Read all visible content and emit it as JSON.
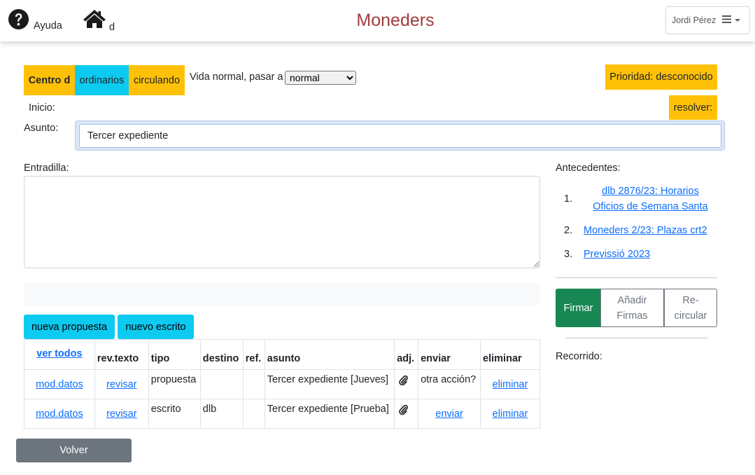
{
  "navbar": {
    "help_label": "Ayuda",
    "home_label": "d",
    "title": "Moneders",
    "user_name": "Jordi Pérez"
  },
  "status": {
    "centro": "Centro d",
    "ordinarios": "ordinarios",
    "circulando": "circulando",
    "vida_label": "Vida normal, pasar a",
    "vida_selected": "normal",
    "prioridad": "Prioridad: desconocido",
    "resolver": "resolver:"
  },
  "form": {
    "inicio_label": "Inicio:",
    "asunto_label": "Asunto:",
    "asunto_value": "Tercer expediente",
    "entradilla_label": "Entradilla:",
    "entradilla_value": ""
  },
  "actions": {
    "nueva_propuesta": "nueva propuesta",
    "nuevo_escrito": "nuevo escrito",
    "volver": "Volver"
  },
  "table": {
    "ver_todos": "ver todos",
    "headers": {
      "rev_texto": "rev.texto",
      "tipo": "tipo",
      "destino": "destino",
      "ref": "ref.",
      "asunto": "asunto",
      "adj": "adj.",
      "enviar": "enviar",
      "eliminar": "eliminar"
    },
    "rows": [
      {
        "mod": "mod.datos",
        "revisar": "revisar",
        "tipo": "propuesta",
        "destino": "",
        "ref": "",
        "asunto": "Tercer expediente [Jueves]",
        "enviar": "otra acción?",
        "eliminar": "eliminar"
      },
      {
        "mod": "mod.datos",
        "revisar": "revisar",
        "tipo": "escrito",
        "destino": "dlb",
        "ref": "",
        "asunto": "Tercer expediente [Prueba]",
        "enviar": "enviar",
        "eliminar": "eliminar"
      }
    ]
  },
  "sidebar": {
    "antecedentes_label": "Antecedentes:",
    "antecedentes": [
      {
        "num": "1.",
        "line1": "dlb 2876/23: Horarios",
        "line2": "Oficios de Semana Santa"
      },
      {
        "num": "2.",
        "line1": "Moneders 2/23: Plazas crt2",
        "line2": ""
      },
      {
        "num": "3.",
        "line1": "Previssió 2023",
        "line2": ""
      }
    ],
    "firmar": "Firmar",
    "anadir_line1": "Añadir",
    "anadir_line2": "Firmas",
    "recircular_line1": "Re-",
    "recircular_line2": "circular",
    "recorrido_label": "Recorrido:"
  },
  "colors": {
    "title": "#a13c3e",
    "yellow": "#ffc107",
    "cyan": "#0dcaf0",
    "green": "#198754",
    "secondary": "#6c757d",
    "link": "#0d6efd"
  },
  "icons": [
    "question-circle-icon",
    "home-icon",
    "hamburger-menu-icon",
    "paperclip-icon"
  ]
}
